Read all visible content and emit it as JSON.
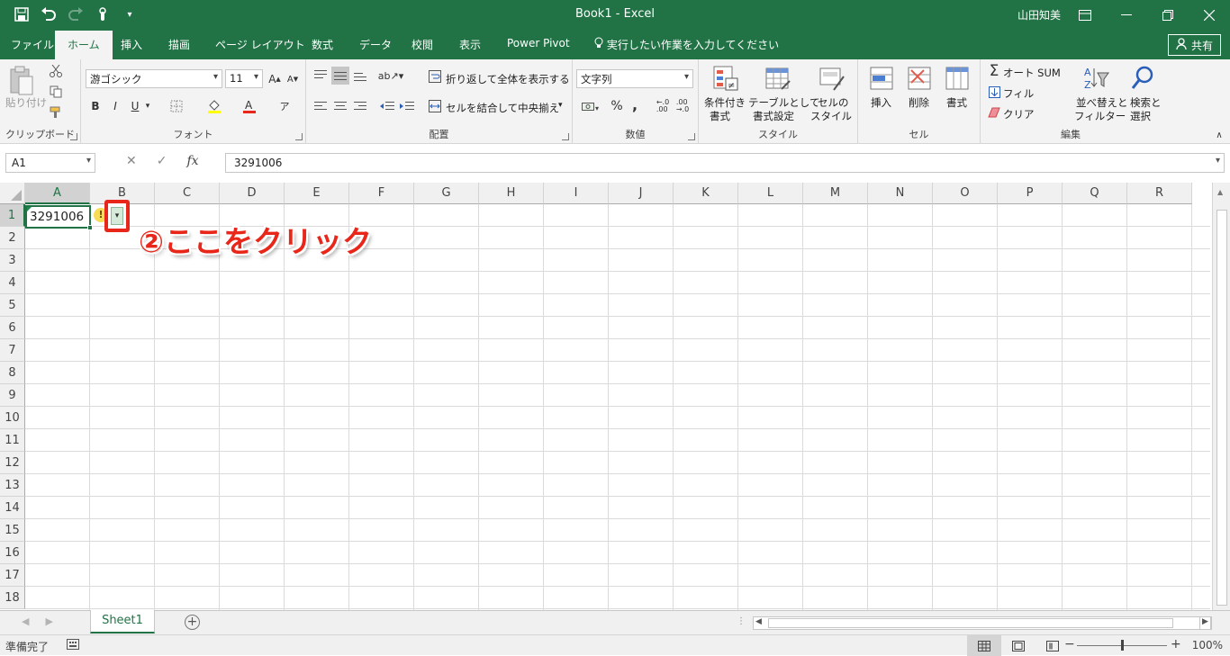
{
  "titlebar": {
    "title": "Book1 - Excel",
    "user": "山田知美",
    "qat_icons": [
      "save-icon",
      "undo-icon",
      "redo-icon",
      "touch-mode-icon",
      "customize-icon"
    ],
    "window_buttons": [
      "ribbon-options-icon",
      "minimize-icon",
      "restore-icon",
      "close-icon"
    ]
  },
  "tabs": [
    {
      "label": "ファイル"
    },
    {
      "label": "ホーム",
      "active": true
    },
    {
      "label": "挿入"
    },
    {
      "label": "描画"
    },
    {
      "label": "ページ レイアウト"
    },
    {
      "label": "数式"
    },
    {
      "label": "データ"
    },
    {
      "label": "校閲"
    },
    {
      "label": "表示"
    },
    {
      "label": "Power Pivot"
    }
  ],
  "tell_me": "実行したい作業を入力してください",
  "share": "共有",
  "ribbon": {
    "clipboard": {
      "label": "クリップボード",
      "paste": "貼り付け"
    },
    "font": {
      "label": "フォント",
      "font_name": "游ゴシック",
      "font_size": "11",
      "bold": "B",
      "italic": "I",
      "underline": "U"
    },
    "alignment": {
      "label": "配置",
      "wrap": "折り返して全体を表示する",
      "merge": "セルを結合して中央揃え"
    },
    "number": {
      "label": "数値",
      "format": "文字列",
      "percent": "%",
      "comma": ","
    },
    "styles": {
      "label": "スタイル",
      "conditional_1": "条件付き",
      "conditional_2": "書式",
      "table_1": "テーブルとして",
      "table_2": "書式設定",
      "cell_1": "セルの",
      "cell_2": "スタイル"
    },
    "cells": {
      "label": "セル",
      "insert": "挿入",
      "delete": "削除",
      "format": "書式"
    },
    "editing": {
      "label": "編集",
      "autosum": "オート SUM",
      "fill": "フィル",
      "clear": "クリア",
      "sort_1": "並べ替えと",
      "sort_2": "フィルター",
      "find_1": "検索と",
      "find_2": "選択"
    }
  },
  "formula_bar": {
    "name_box": "A1",
    "cancel": "✕",
    "enter": "✓",
    "fx": "fx",
    "content": "3291006"
  },
  "columns": [
    "A",
    "B",
    "C",
    "D",
    "E",
    "F",
    "G",
    "H",
    "I",
    "J",
    "K",
    "L",
    "M",
    "N",
    "O",
    "P",
    "Q",
    "R"
  ],
  "rows": [
    "1",
    "2",
    "3",
    "4",
    "5",
    "6",
    "7",
    "8",
    "9",
    "10",
    "11",
    "12",
    "13",
    "14",
    "15",
    "16",
    "17",
    "18"
  ],
  "cell_a1": "3291006",
  "callout": "②ここをクリック",
  "sheet": {
    "name": "Sheet1",
    "add": "+"
  },
  "status": {
    "ready": "準備完了",
    "zoom": "100%",
    "minus": "−",
    "plus": "+"
  },
  "colors": {
    "excel_green": "#217346",
    "callout_red": "#e8271a"
  }
}
